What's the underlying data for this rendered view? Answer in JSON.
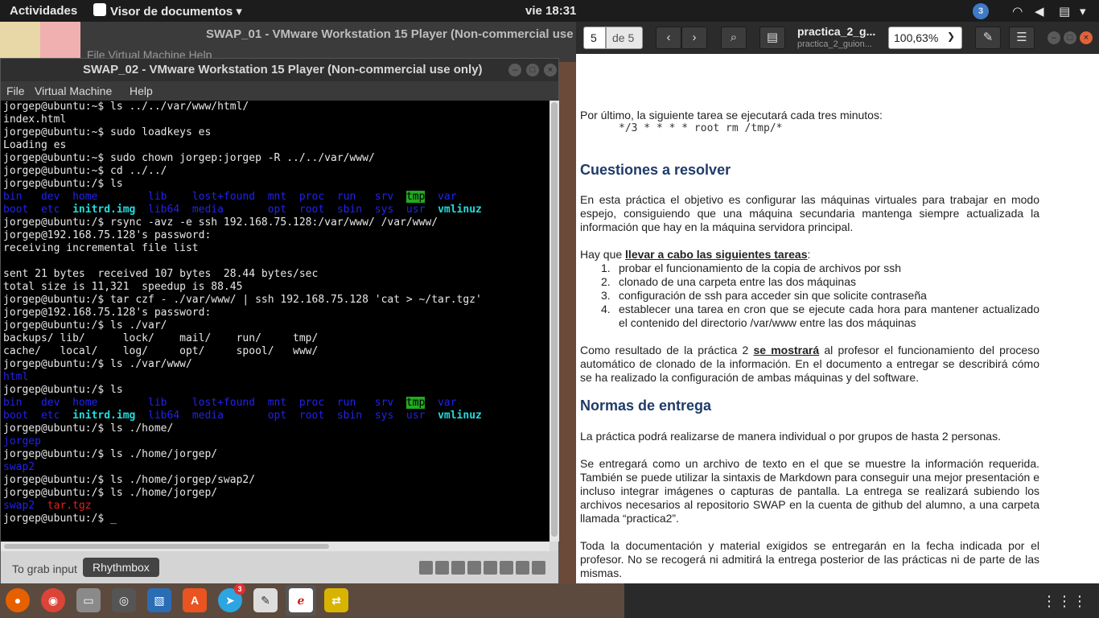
{
  "topbar": {
    "activities": "Actividades",
    "app_name": "Visor de documentos",
    "clock": "vie 18:31",
    "notification_count": "3"
  },
  "back_window": {
    "title": "SWAP_01 - VMware Workstation 15 Player (Non-commercial use",
    "menu": "File   Virtual Machine   Help"
  },
  "vm_window": {
    "title": "SWAP_02 - VMware Workstation 15 Player (Non-commercial use only)",
    "menu": {
      "file": "File",
      "vm": "Virtual Machine",
      "help": "Help"
    },
    "status_hint": "To grab input",
    "tooltip": "Rhythmbox"
  },
  "terminal": {
    "lines": [
      [
        {
          "t": "jorgep@ubuntu:~$ ls ../../var/www/html/"
        }
      ],
      [
        {
          "t": "index.html"
        }
      ],
      [
        {
          "t": "jorgep@ubuntu:~$ sudo loadkeys es"
        }
      ],
      [
        {
          "t": "Loading es"
        }
      ],
      [
        {
          "t": "jorgep@ubuntu:~$ sudo chown jorgep:jorgep -R ../../var/www/"
        }
      ],
      [
        {
          "t": "jorgep@ubuntu:~$ cd ../../"
        }
      ],
      [
        {
          "t": "jorgep@ubuntu:/$ ls"
        }
      ],
      [
        {
          "t": "bin   dev  home        lib    lost+found  mnt  proc  run   srv  ",
          "c": "blue"
        },
        {
          "t": "tmp",
          "c": "hl"
        },
        {
          "t": "  var",
          "c": "blue"
        }
      ],
      [
        {
          "t": "boot  etc  ",
          "c": "blue"
        },
        {
          "t": "initrd.img",
          "c": "cyan"
        },
        {
          "t": "  lib64  media       opt  root  sbin  sys  usr  ",
          "c": "blue"
        },
        {
          "t": "vmlinuz",
          "c": "cyan"
        }
      ],
      [
        {
          "t": "jorgep@ubuntu:/$ rsync -avz -e ssh 192.168.75.128:/var/www/ /var/www/"
        }
      ],
      [
        {
          "t": "jorgep@192.168.75.128's password:"
        }
      ],
      [
        {
          "t": "receiving incremental file list"
        }
      ],
      [
        {
          "t": ""
        }
      ],
      [
        {
          "t": "sent 21 bytes  received 107 bytes  28.44 bytes/sec"
        }
      ],
      [
        {
          "t": "total size is 11,321  speedup is 88.45"
        }
      ],
      [
        {
          "t": "jorgep@ubuntu:/$ tar czf - ./var/www/ | ssh 192.168.75.128 'cat > ~/tar.tgz'"
        }
      ],
      [
        {
          "t": "jorgep@192.168.75.128's password:"
        }
      ],
      [
        {
          "t": "jorgep@ubuntu:/$ ls ./var/"
        }
      ],
      [
        {
          "t": "backups/ lib/      lock/    mail/    run/     tmp/"
        }
      ],
      [
        {
          "t": "cache/   local/    log/     opt/     spool/   www/"
        }
      ],
      [
        {
          "t": "jorgep@ubuntu:/$ ls ./var/www/"
        }
      ],
      [
        {
          "t": "html",
          "c": "blue"
        }
      ],
      [
        {
          "t": "jorgep@ubuntu:/$ ls"
        }
      ],
      [
        {
          "t": "bin   dev  home        lib    lost+found  mnt  proc  run   srv  ",
          "c": "blue"
        },
        {
          "t": "tmp",
          "c": "hl"
        },
        {
          "t": "  var",
          "c": "blue"
        }
      ],
      [
        {
          "t": "boot  etc  ",
          "c": "blue"
        },
        {
          "t": "initrd.img",
          "c": "cyan"
        },
        {
          "t": "  lib64  media       opt  root  sbin  sys  usr  ",
          "c": "blue"
        },
        {
          "t": "vmlinuz",
          "c": "cyan"
        }
      ],
      [
        {
          "t": "jorgep@ubuntu:/$ ls ./home/"
        }
      ],
      [
        {
          "t": "jorgep",
          "c": "blue"
        }
      ],
      [
        {
          "t": "jorgep@ubuntu:/$ ls ./home/jorgep/"
        }
      ],
      [
        {
          "t": "swap2",
          "c": "blue"
        }
      ],
      [
        {
          "t": "jorgep@ubuntu:/$ ls ./home/jorgep/swap2/"
        }
      ],
      [
        {
          "t": "jorgep@ubuntu:/$ ls ./home/jorgep/"
        }
      ],
      [
        {
          "t": "swap2  ",
          "c": "blue"
        },
        {
          "t": "tar.tgz",
          "c": "red"
        }
      ],
      [
        {
          "t": "jorgep@ubuntu:/$ _"
        }
      ]
    ]
  },
  "viewer": {
    "page_current": "5",
    "page_total": "de 5",
    "doc_title": "practica_2_g...",
    "doc_subtitle": "practica_2_guion...",
    "zoom": "100,63%",
    "body": {
      "intro": "Por último, la siguiente tarea se ejecutará cada tres minutos:",
      "cron": "*/3 * * * * root rm /tmp/*",
      "h_cuestiones": "Cuestiones a resolver",
      "p1": "En esta práctica el objetivo es configurar las máquinas virtuales para trabajar en modo espejo, consiguiendo que una máquina secundaria mantenga siempre actualizada la información que hay en la máquina servidora principal.",
      "p2_lead": "Hay que ",
      "p2_bold": "llevar a cabo las siguientes tareas",
      "p2_tail": ":",
      "tasks": [
        {
          "n": "1.",
          "t": "probar el funcionamiento de la copia de archivos por ssh"
        },
        {
          "n": "2.",
          "t": "clonado de una carpeta entre las dos máquinas"
        },
        {
          "n": "3.",
          "t": "configuración de ssh para acceder sin que solicite contraseña"
        },
        {
          "n": "4.",
          "t": "establecer una tarea en cron que se ejecute cada hora para mantener actualizado el contenido del directorio /var/www entre las dos máquinas"
        }
      ],
      "p3_a": "Como resultado de la práctica 2 ",
      "p3_bold": "se mostrará",
      "p3_b": " al profesor el funcionamiento del proceso automático de clonado de la información. En el documento a entregar se describirá cómo se ha realizado la configuración de ambas máquinas y del software.",
      "h_normas": "Normas de entrega",
      "p4": "La práctica podrá realizarse de manera individual o por grupos de hasta 2 personas.",
      "p5": "Se entregará como un archivo de texto en el que se muestre la información requerida. También se puede utilizar la sintaxis de Markdown para conseguir una mejor presentación e incluso integrar imágenes o capturas de pantalla. La entrega se realizará subiendo los archivos necesarios al repositorio SWAP en la cuenta de github del alumno, a una carpeta llamada “practica2”.",
      "p6": "Toda la documentación y material exigidos se entregarán en la fecha indicada por el profesor. No se recogerá ni admitirá la entrega posterior de las prácticas ni de parte de las mismas."
    }
  },
  "dock": {
    "telegram_badge": "3",
    "apps": [
      "firefox-icon",
      "chrome-icon",
      "files-icon",
      "vmware-icon",
      "writer-icon",
      "software-icon",
      "telegram-icon",
      "text-editor-icon",
      "document-viewer-icon",
      "network-icon"
    ]
  },
  "colors": {
    "heading": "#1f3b68",
    "terminal_bg": "#000000",
    "topbar_bg": "#1c1c1c"
  }
}
